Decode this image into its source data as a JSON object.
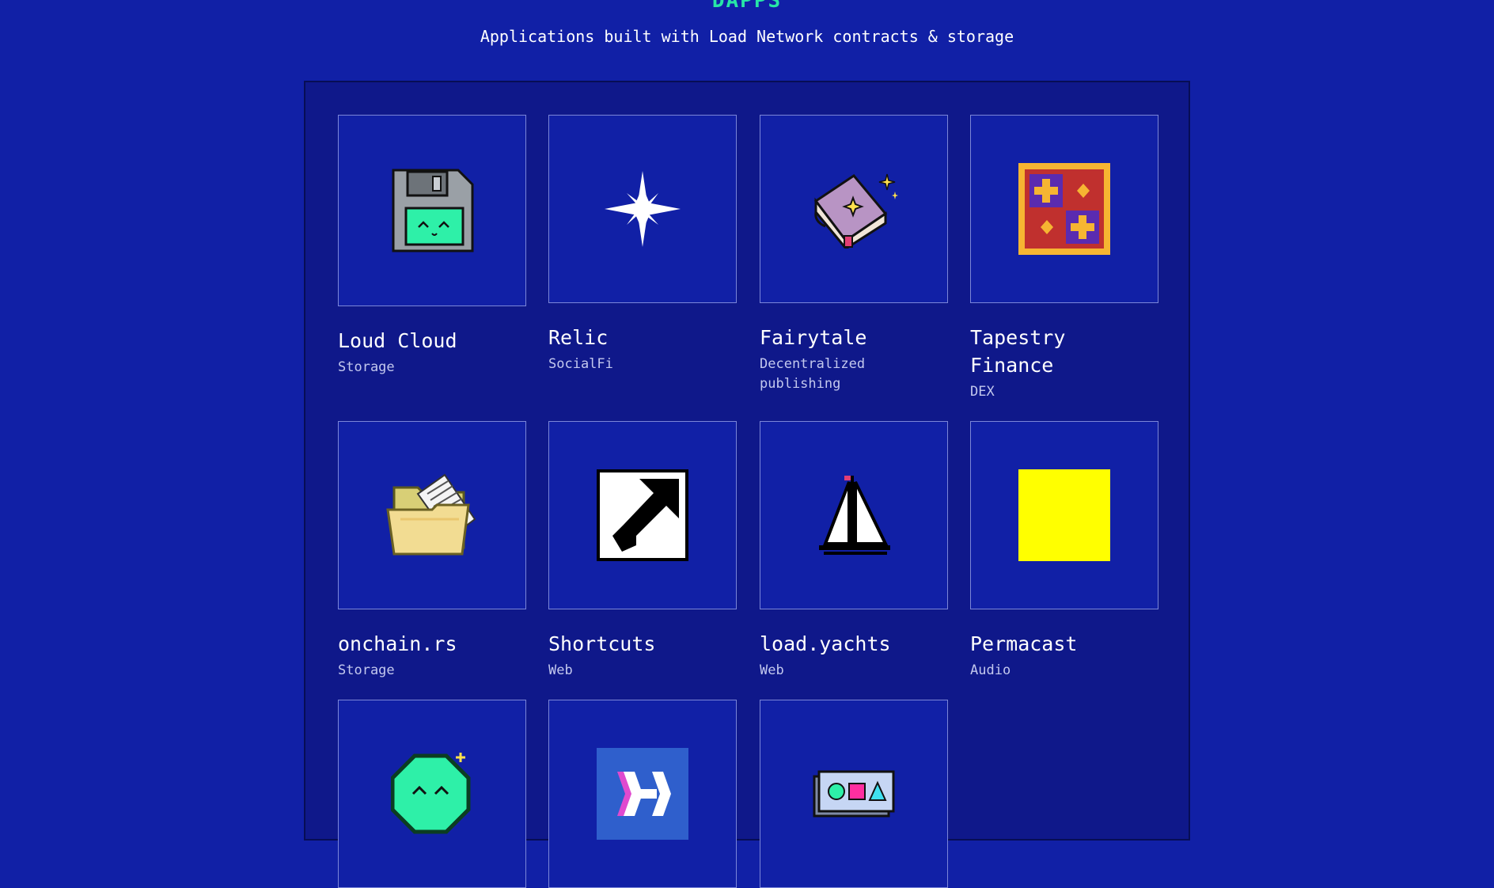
{
  "header": {
    "title": "DAPPS",
    "subtitle": "Applications built with Load Network contracts & storage"
  },
  "colors": {
    "background": "#1120a6",
    "panel": "#0f188a",
    "accent": "#27e6a6",
    "tile_border": "#7b86d8"
  },
  "dapps": [
    {
      "name": "Loud Cloud",
      "category": "Storage",
      "icon": "floppy-disk-icon"
    },
    {
      "name": "Relic",
      "category": "SocialFi",
      "icon": "sparkle-star-icon"
    },
    {
      "name": "Fairytale",
      "category": "Decentralized publishing",
      "icon": "magic-book-icon"
    },
    {
      "name": "Tapestry Finance",
      "category": "DEX",
      "icon": "quilt-pattern-icon"
    },
    {
      "name": "onchain.rs",
      "category": "Storage",
      "icon": "folder-icon"
    },
    {
      "name": "Shortcuts",
      "category": "Web",
      "icon": "shortcut-arrow-icon"
    },
    {
      "name": "load.yachts",
      "category": "Web",
      "icon": "sailboat-icon"
    },
    {
      "name": "Permacast",
      "category": "Audio",
      "icon": "yellow-square-icon"
    },
    {
      "icon": "smiling-gem-icon"
    },
    {
      "icon": "h-logo-icon"
    },
    {
      "icon": "shapes-card-icon"
    }
  ]
}
